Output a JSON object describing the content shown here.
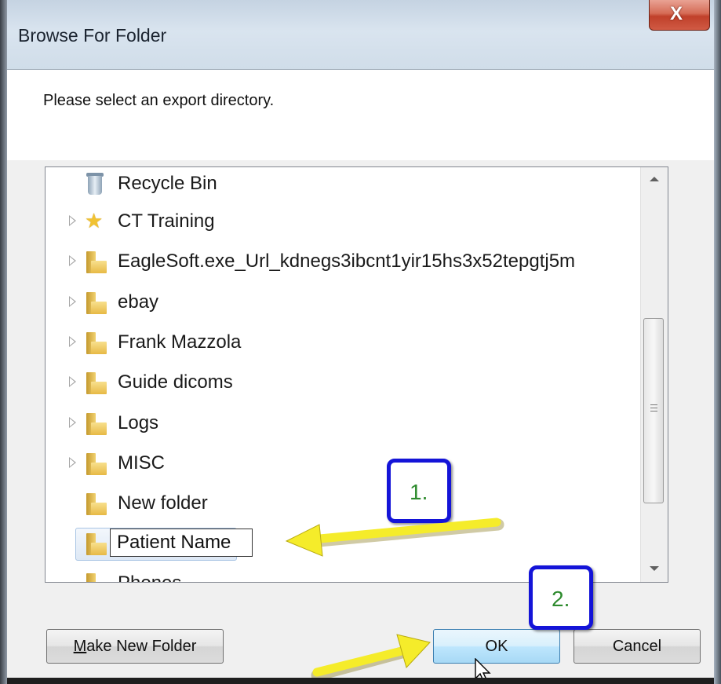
{
  "dialog": {
    "title": "Browse For Folder",
    "close_label": "X",
    "prompt": "Please select an export directory."
  },
  "tree": {
    "items": [
      {
        "label": "Recycle Bin",
        "icon": "recycle-bin-icon",
        "expandable": false
      },
      {
        "label": "CT Training",
        "icon": "star-icon",
        "expandable": true
      },
      {
        "label": "EagleSoft.exe_Url_kdnegs3ibcnt1yir15hs3x52tepgtj5m",
        "icon": "folder-icon",
        "expandable": true
      },
      {
        "label": "ebay",
        "icon": "folder-icon",
        "expandable": true
      },
      {
        "label": "Frank Mazzola",
        "icon": "folder-icon",
        "expandable": true
      },
      {
        "label": "Guide dicoms",
        "icon": "folder-icon",
        "expandable": true
      },
      {
        "label": "Logs",
        "icon": "folder-icon",
        "expandable": true
      },
      {
        "label": "MISC",
        "icon": "folder-icon",
        "expandable": true
      },
      {
        "label": "New folder",
        "icon": "folder-icon",
        "expandable": false
      },
      {
        "label": "Patient Name",
        "icon": "folder-icon",
        "expandable": false,
        "editing": true
      },
      {
        "label": "Phones",
        "icon": "folder-icon",
        "expandable": false
      }
    ]
  },
  "buttons": {
    "make_new_folder_mnemonic": "M",
    "make_new_folder_rest": "ake New Folder",
    "ok": "OK",
    "cancel": "Cancel"
  },
  "annotations": [
    {
      "label": "1.",
      "color": "#1414d8",
      "text_color": "#2e8b2e"
    },
    {
      "label": "2.",
      "color": "#1414d8",
      "text_color": "#2e8b2e"
    }
  ],
  "colors": {
    "arrow_yellow": "#f5ec2a",
    "close_red": "#c94a35",
    "ok_blue": "#bee6fd"
  }
}
